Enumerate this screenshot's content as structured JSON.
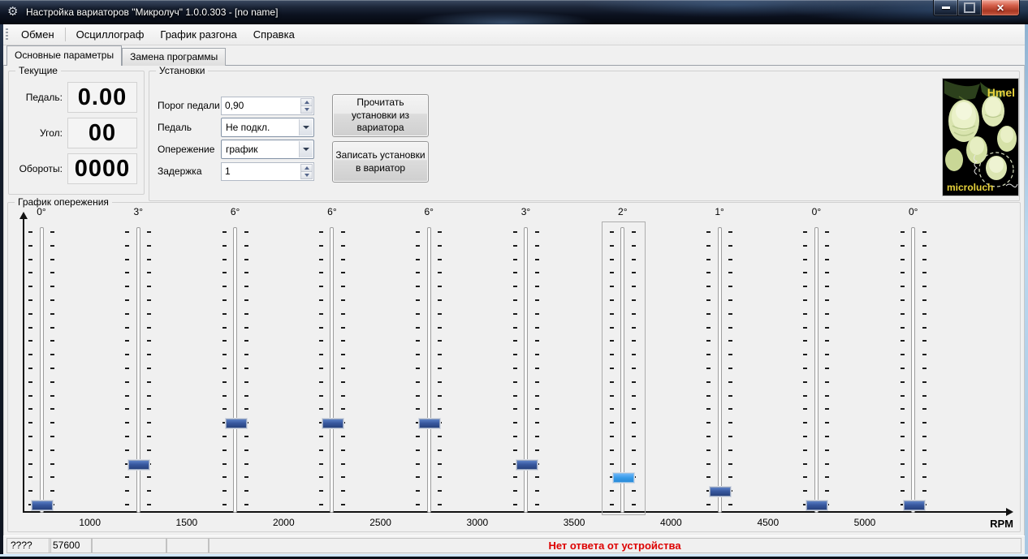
{
  "window": {
    "title": "Настройка вариаторов \"Микролуч\" 1.0.0.303 - [no name]",
    "app_icon_glyph": "⚙",
    "close_glyph": "✕"
  },
  "menu": {
    "items": [
      "Обмен",
      "Осциллограф",
      "График разгона",
      "Справка"
    ]
  },
  "tabs": [
    {
      "label": "Основные параметры",
      "active": true
    },
    {
      "label": "Замена программы",
      "active": false
    }
  ],
  "current": {
    "legend": "Текущие",
    "rows": [
      {
        "label": "Педаль:",
        "value": "0.00"
      },
      {
        "label": "Угол:",
        "value": "00"
      },
      {
        "label": "Обороты:",
        "value": "0000"
      }
    ]
  },
  "settings": {
    "legend": "Установки",
    "fields": [
      {
        "label": "Порог педали",
        "value": "0,90",
        "type": "spin"
      },
      {
        "label": "Педаль",
        "value": "Не подкл.",
        "type": "combo"
      },
      {
        "label": "Опережение",
        "value": "график",
        "type": "combo"
      },
      {
        "label": "Задержка",
        "value": "1",
        "type": "spin"
      }
    ],
    "buttons": [
      "Прочитать установки из вариатора",
      "Записать установки в вариатор"
    ],
    "logo": {
      "top_text": "Hmel",
      "bottom_text": "microluch"
    }
  },
  "graph": {
    "legend": "График опережения",
    "sliders": [
      {
        "label": "0°",
        "value": 0
      },
      {
        "label": "3°",
        "value": 3
      },
      {
        "label": "6°",
        "value": 6
      },
      {
        "label": "6°",
        "value": 6
      },
      {
        "label": "6°",
        "value": 6
      },
      {
        "label": "3°",
        "value": 3
      },
      {
        "label": "2°",
        "value": 2,
        "focused": true
      },
      {
        "label": "1°",
        "value": 1
      },
      {
        "label": "0°",
        "value": 0
      },
      {
        "label": "0°",
        "value": 0
      }
    ],
    "tick_rows": 21,
    "x_labels": [
      "1000",
      "1500",
      "2000",
      "2500",
      "3000",
      "3500",
      "4000",
      "4500",
      "5000"
    ],
    "axis_label": "RPM"
  },
  "statusbar": {
    "panels": [
      "????",
      "57600",
      "",
      ""
    ],
    "message": "Нет ответа от устройства",
    "message_color": "#dd0000"
  }
}
